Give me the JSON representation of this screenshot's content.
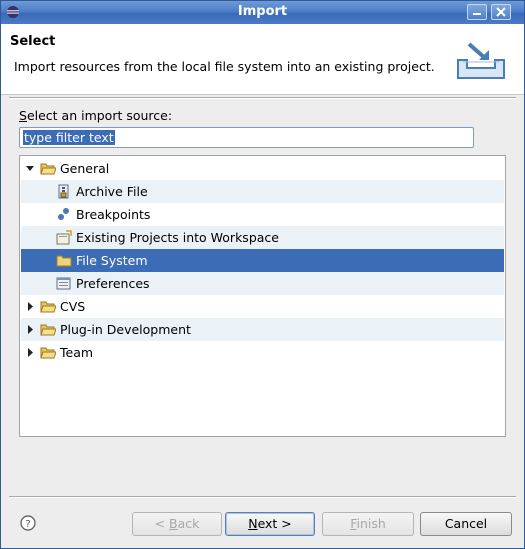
{
  "window": {
    "title": "Import"
  },
  "header": {
    "title": "Select",
    "description": "Import resources from the local file system into an existing project."
  },
  "source": {
    "label_prefix": "",
    "label_mnemonic": "S",
    "label_rest": "elect an import source:",
    "filter_value": "type filter text"
  },
  "tree": {
    "items": [
      {
        "label": "General",
        "icon": "folder-open-icon",
        "expanded": true
      },
      {
        "label": "Archive File",
        "icon": "archive-file-icon"
      },
      {
        "label": "Breakpoints",
        "icon": "breakpoints-icon"
      },
      {
        "label": "Existing Projects into Workspace",
        "icon": "existing-projects-icon"
      },
      {
        "label": "File System",
        "icon": "folder-icon",
        "selected": true
      },
      {
        "label": "Preferences",
        "icon": "preferences-icon"
      },
      {
        "label": "CVS",
        "icon": "folder-icon",
        "expanded": false
      },
      {
        "label": "Plug-in Development",
        "icon": "folder-icon",
        "expanded": false
      },
      {
        "label": "Team",
        "icon": "folder-icon",
        "expanded": false
      }
    ]
  },
  "buttons": {
    "back_prefix": "< ",
    "back_mnemonic": "B",
    "back_rest": "ack",
    "next_mnemonic": "N",
    "next_rest": "ext >",
    "finish_mnemonic": "F",
    "finish_rest": "inish",
    "cancel": "Cancel"
  },
  "colors": {
    "titlebar": "#4c7ec8",
    "selection": "#3d6cb6",
    "alt_row": "#eaf2f8"
  }
}
